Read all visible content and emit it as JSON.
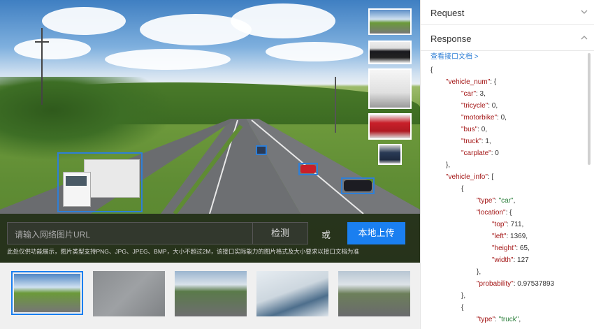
{
  "viewer": {
    "url_placeholder": "请输入网络图片URL",
    "detect_label": "检测",
    "or_label": "或",
    "upload_label": "本地上传",
    "hint": "此处仅供功能展示，图片类型支持PNG、JPG、JPEG、BMP，大小不超过2M，该接口实际能力的图片格式及大小要求以接口文档为准"
  },
  "panel": {
    "request_title": "Request",
    "response_title": "Response",
    "doc_link": "查看接口文档 >",
    "json_lines": [
      {
        "indent": 0,
        "text": "{"
      },
      {
        "indent": 1,
        "key": "\"vehicle_num\"",
        "rest": ": {"
      },
      {
        "indent": 2,
        "key": "\"car\"",
        "rest": ": 3,"
      },
      {
        "indent": 2,
        "key": "\"tricycle\"",
        "rest": ": 0,"
      },
      {
        "indent": 2,
        "key": "\"motorbike\"",
        "rest": ": 0,"
      },
      {
        "indent": 2,
        "key": "\"bus\"",
        "rest": ": 0,"
      },
      {
        "indent": 2,
        "key": "\"truck\"",
        "rest": ": 1,"
      },
      {
        "indent": 2,
        "key": "\"carplate\"",
        "rest": ": 0"
      },
      {
        "indent": 1,
        "text": "},"
      },
      {
        "indent": 1,
        "key": "\"vehicle_info\"",
        "rest": ": ["
      },
      {
        "indent": 2,
        "text": "{"
      },
      {
        "indent": 3,
        "key": "\"type\"",
        "rest": ": ",
        "str": "\"car\"",
        "tail": ","
      },
      {
        "indent": 3,
        "key": "\"location\"",
        "rest": ": {"
      },
      {
        "indent": 4,
        "key": "\"top\"",
        "rest": ": 711,"
      },
      {
        "indent": 4,
        "key": "\"left\"",
        "rest": ": 1369,"
      },
      {
        "indent": 4,
        "key": "\"height\"",
        "rest": ": 65,"
      },
      {
        "indent": 4,
        "key": "\"width\"",
        "rest": ": 127"
      },
      {
        "indent": 3,
        "text": "},"
      },
      {
        "indent": 3,
        "key": "\"probability\"",
        "rest": ": 0.97537893"
      },
      {
        "indent": 2,
        "text": "},"
      },
      {
        "indent": 2,
        "text": "{"
      },
      {
        "indent": 3,
        "key": "\"type\"",
        "rest": ": ",
        "str": "\"truck\"",
        "tail": ","
      }
    ]
  },
  "colors": {
    "accent": "#1a7ff0",
    "bbox": "#2f7fd6",
    "json_key": "#a31515",
    "json_string": "#2a7e3a"
  },
  "icons": {
    "request_chevron": "chevron-down-icon",
    "response_chevron": "chevron-up-icon"
  }
}
